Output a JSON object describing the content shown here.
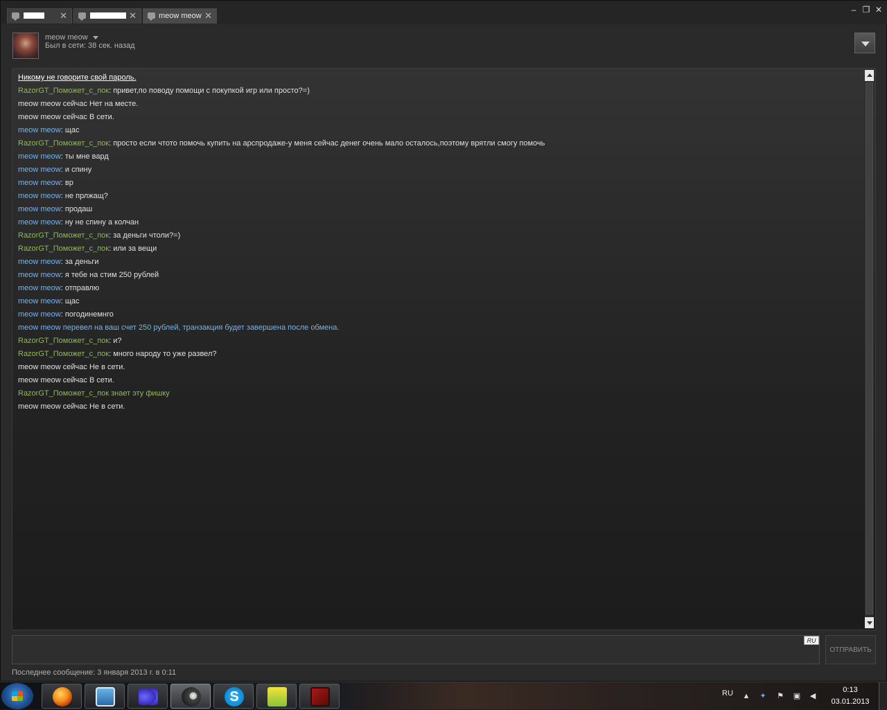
{
  "tabs": [
    {
      "label": "",
      "redacted": true
    },
    {
      "label": "",
      "redacted": true
    },
    {
      "label": "meow meow",
      "active": true
    }
  ],
  "window_controls": {
    "minimize": "–",
    "restore": "❐",
    "close": "✕"
  },
  "header": {
    "friend_name": "meow meow",
    "status": "Был в сети: 38 сек. назад"
  },
  "messages": [
    {
      "kind": "notice",
      "text": "Никому не говорите свой пароль."
    },
    {
      "kind": "you",
      "sender": "RazorGT_Поможет_с_пок",
      "text": ": привет,по поводу помощи с покупкой игр или просто?=)"
    },
    {
      "kind": "system",
      "text": "meow meow сейчас Нет на месте."
    },
    {
      "kind": "system",
      "text": "meow meow сейчас В сети."
    },
    {
      "kind": "friend",
      "sender": "meow meow",
      "text": ": щас"
    },
    {
      "kind": "you",
      "sender": "RazorGT_Поможет_с_пок",
      "text": ": просто если чтото помочь купить на арспродаже-у меня сейчас денег очень мало осталось,поэтому врятли смогу помочь"
    },
    {
      "kind": "friend",
      "sender": "meow meow",
      "text": ": ты мне вард"
    },
    {
      "kind": "friend",
      "sender": "meow meow",
      "text": ": и спину"
    },
    {
      "kind": "friend",
      "sender": "meow meow",
      "text": ": вр"
    },
    {
      "kind": "friend",
      "sender": "meow meow",
      "text": ": не прлжащ?"
    },
    {
      "kind": "friend",
      "sender": "meow meow",
      "text": ": продаш"
    },
    {
      "kind": "friend",
      "sender": "meow meow",
      "text": ": ну не спину а колчан"
    },
    {
      "kind": "you",
      "sender": "RazorGT_Поможет_с_пок",
      "text": ": за деньги чтоли?=)"
    },
    {
      "kind": "you",
      "sender": "RazorGT_Поможет_с_пок",
      "text": ": или за вещи"
    },
    {
      "kind": "friend",
      "sender": "meow meow",
      "text": ": за деньги"
    },
    {
      "kind": "friend",
      "sender": "meow meow",
      "text": ": я тебе на стим 250 рублей"
    },
    {
      "kind": "friend",
      "sender": "meow meow",
      "text": ": отправлю"
    },
    {
      "kind": "friend",
      "sender": "meow meow",
      "text": ": щас"
    },
    {
      "kind": "friend",
      "sender": "meow meow",
      "text": ": погодинемнго"
    },
    {
      "kind": "emote-friend",
      "text": "meow meow перевел на ваш счет 250 рублей, транзакция будет завершена после обмена."
    },
    {
      "kind": "you",
      "sender": "RazorGT_Поможет_с_пок",
      "text": ": и?"
    },
    {
      "kind": "you",
      "sender": "RazorGT_Поможет_с_пок",
      "text": ": много народу то уже развел?"
    },
    {
      "kind": "system",
      "text": "meow meow сейчас Не в сети."
    },
    {
      "kind": "system",
      "text": "meow meow сейчас В сети."
    },
    {
      "kind": "emote-you",
      "text": "RazorGT_Поможет_с_пок знает эту фишку"
    },
    {
      "kind": "system",
      "text": "meow meow сейчас Не в сети."
    }
  ],
  "input": {
    "value": "",
    "lang_badge": "RU"
  },
  "send_label": "ОТПРАВИТЬ",
  "last_message": "Последнее сообщение: 3 января 2013 г. в 0:11",
  "taskbar": {
    "apps": [
      "firefox-icon",
      "media-player-icon",
      "butterfly-app-icon",
      "steam-icon",
      "skype-icon",
      "game-icon",
      "dota-icon"
    ],
    "skype_glyph": "S",
    "lang": "RU",
    "time": "0:13",
    "date": "03.01.2013"
  },
  "colors": {
    "you": "#8fb85b",
    "friend": "#7ab3e6",
    "text": "#e0e0e0"
  }
}
